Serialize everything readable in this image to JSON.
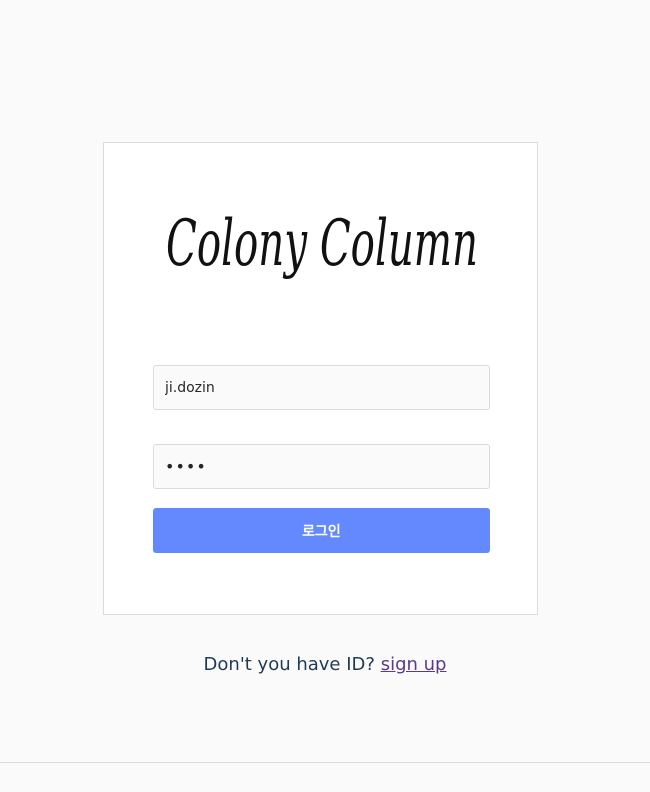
{
  "login": {
    "logo_text": "Colony Column",
    "username_value": "ji.dozin",
    "password_value": "1234",
    "submit_label": "로그인"
  },
  "signup": {
    "prompt_text": "Don't you have ID?",
    "link_text": "sign up"
  },
  "colors": {
    "page_background": "#fafafa",
    "card_background": "#ffffff",
    "button_primary": "#6489ff",
    "prompt_text": "#1f3a52",
    "link_text": "#5b3a8a"
  }
}
